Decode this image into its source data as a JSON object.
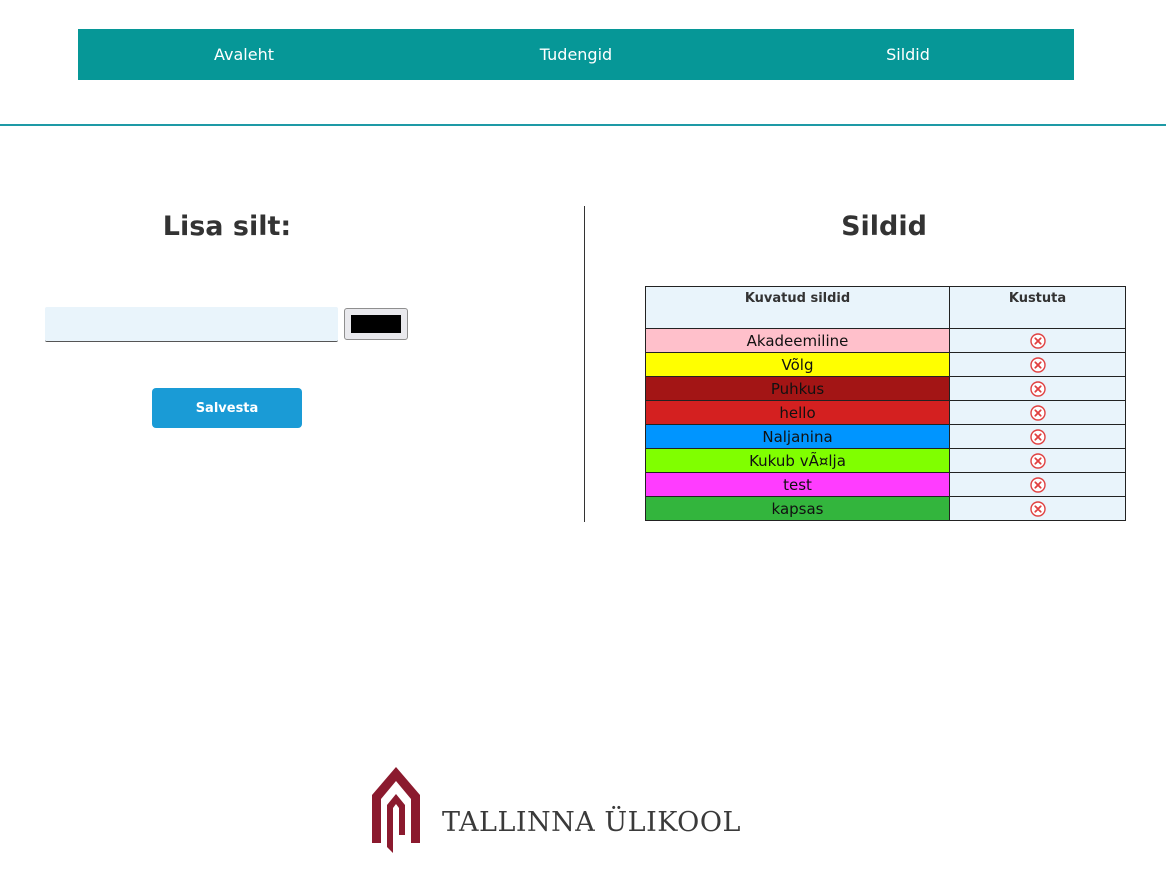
{
  "nav": {
    "items": [
      {
        "label": "Avaleht"
      },
      {
        "label": "Tudengid"
      },
      {
        "label": "Sildid"
      }
    ]
  },
  "add_tag": {
    "heading": "Lisa silt:",
    "name_value": "",
    "color_value": "#000000",
    "save_label": "Salvesta"
  },
  "tags": {
    "heading": "Sildid",
    "columns": [
      "Kuvatud sildid",
      "Kustuta"
    ],
    "rows": [
      {
        "name": "Akadeemiline",
        "color": "#ffc0cb",
        "delete_icon": "close-circle-icon"
      },
      {
        "name": "Võlg",
        "color": "#ffff00",
        "delete_icon": "close-circle-icon"
      },
      {
        "name": "Puhkus",
        "color": "#a31515",
        "delete_icon": "close-circle-icon"
      },
      {
        "name": "hello",
        "color": "#d42020",
        "delete_icon": "close-circle-icon"
      },
      {
        "name": "Naljanina",
        "color": "#0095ff",
        "delete_icon": "close-circle-icon"
      },
      {
        "name": "Kukub vÃ¤lja",
        "color": "#80ff00",
        "delete_icon": "close-circle-icon"
      },
      {
        "name": "test",
        "color": "#ff3cff",
        "delete_icon": "close-circle-icon"
      },
      {
        "name": "kapsas",
        "color": "#33b53d",
        "delete_icon": "close-circle-icon"
      }
    ]
  },
  "colors": {
    "nav_bg": "#069797",
    "nav_rule": "#1e9aa6",
    "button_bg": "#1a9bd6",
    "input_bg": "#e9f4fb",
    "logo_red": "#8b1a2e"
  },
  "footer": {
    "logo_text": "TALLINNA ÜLIKOOL",
    "logo_icon": "tallinn-university-logo-icon"
  }
}
